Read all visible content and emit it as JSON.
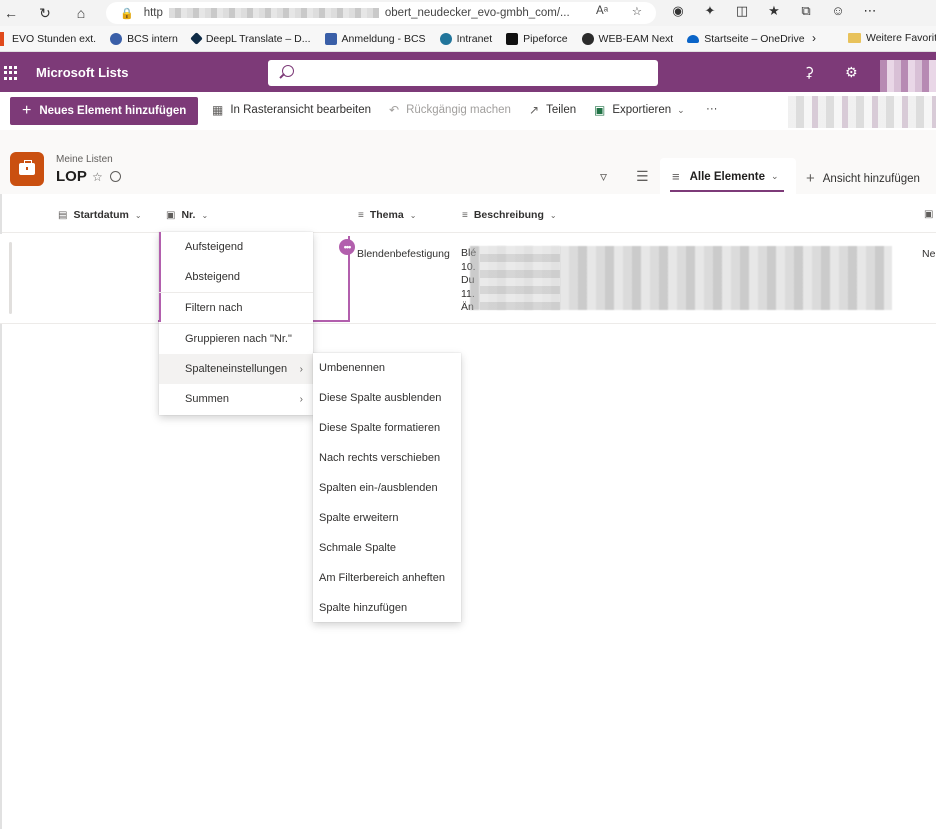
{
  "browser": {
    "url_start": "http",
    "url_end": "obert_neudecker_evo-gmbh_com/...",
    "read_aloud": "Aᵃ"
  },
  "favorites": [
    {
      "label": "EVO Stunden ext.",
      "color": "#e04a1c"
    },
    {
      "label": "BCS intern",
      "color": "#3a5fa8"
    },
    {
      "label": "DeepL Translate – D...",
      "color": "#0f2b46"
    },
    {
      "label": "Anmeldung - BCS",
      "color": "#3a5fa8"
    },
    {
      "label": "Intranet",
      "color": "#21759b"
    },
    {
      "label": "Pipeforce",
      "color": "#111111"
    },
    {
      "label": "WEB-EAM Next",
      "color": "#2b2b2b"
    },
    {
      "label": "Startseite – OneDrive",
      "color": "#0a64c8"
    }
  ],
  "favorites_more": "Weitere Favorit",
  "suite": {
    "app_title": "Microsoft Lists",
    "accent": "#7d3a78"
  },
  "commands": {
    "new_item": "Neues Element hinzufügen",
    "grid_edit": "In Rasteransicht bearbeiten",
    "undo": "Rückgängig machen",
    "share": "Teilen",
    "export": "Exportieren",
    "more": "···"
  },
  "list": {
    "breadcrumb": "Meine Listen",
    "name": "LOP",
    "icon_color": "#ca5010"
  },
  "views": {
    "current": "Alle Elemente",
    "add": "Ansicht hinzufügen"
  },
  "columns": {
    "startdatum": "Startdatum",
    "nr": "Nr.",
    "thema": "Thema",
    "beschreibung": "Beschreibung"
  },
  "row": {
    "thema": "Blendenbefestigung",
    "desc_lines": [
      "Blé",
      "10.",
      "Du",
      "11.",
      "Än"
    ],
    "last_col": "Ne"
  },
  "column_menu": {
    "items": [
      "Aufsteigend",
      "Absteigend",
      "Filtern nach",
      "Gruppieren nach \"Nr.\"",
      "Spalteneinstellungen",
      "Summen"
    ]
  },
  "settings_submenu": {
    "items": [
      "Umbenennen",
      "Diese Spalte ausblenden",
      "Diese Spalte formatieren",
      "Nach rechts verschieben",
      "Spalten ein-/ausblenden",
      "Spalte erweitern",
      "Schmale Spalte",
      "Am Filterbereich anheften",
      "Spalte hinzufügen"
    ]
  }
}
